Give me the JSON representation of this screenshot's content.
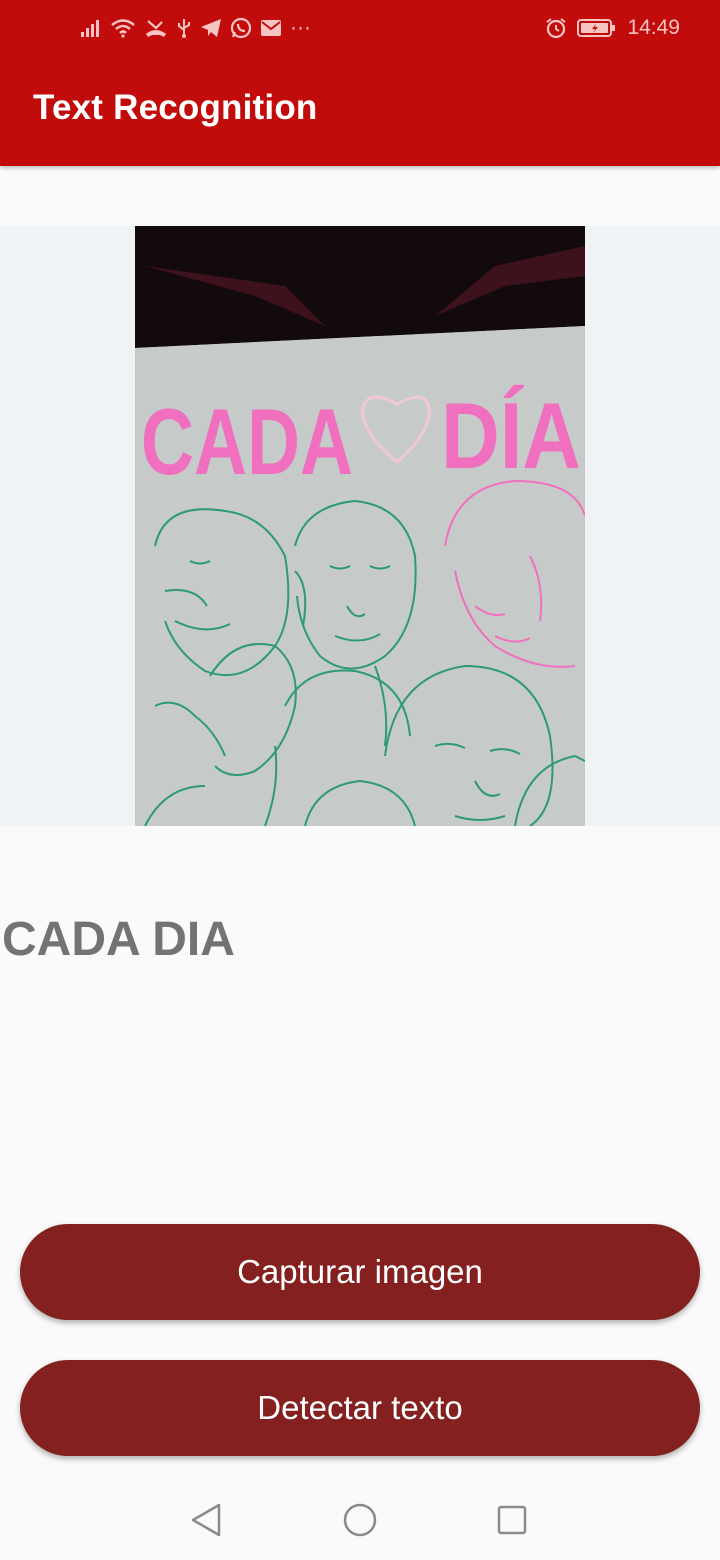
{
  "status_bar": {
    "time": "14:49",
    "icons_left": [
      "signal-icon",
      "wifi-icon",
      "missed-call-icon",
      "usb-icon",
      "telegram-icon",
      "whatsapp-icon",
      "mail-icon",
      "more-dots-icon"
    ],
    "icons_right": [
      "alarm-icon",
      "battery-charging-icon"
    ],
    "overflow": "···"
  },
  "toolbar": {
    "title": "Text Recognition"
  },
  "image": {
    "words": [
      "CADA",
      "DÍA"
    ]
  },
  "result": {
    "text": "CADA DIA"
  },
  "buttons": {
    "capture_label": "Capturar imagen",
    "detect_label": "Detectar texto"
  },
  "nav": {
    "icons": [
      "back-icon",
      "home-icon",
      "recents-icon"
    ]
  },
  "colors": {
    "primary": "#c20c0c",
    "button": "#852020",
    "result_text": "#737373",
    "image_pink": "#f06fbf",
    "image_green": "#2e9a74"
  }
}
